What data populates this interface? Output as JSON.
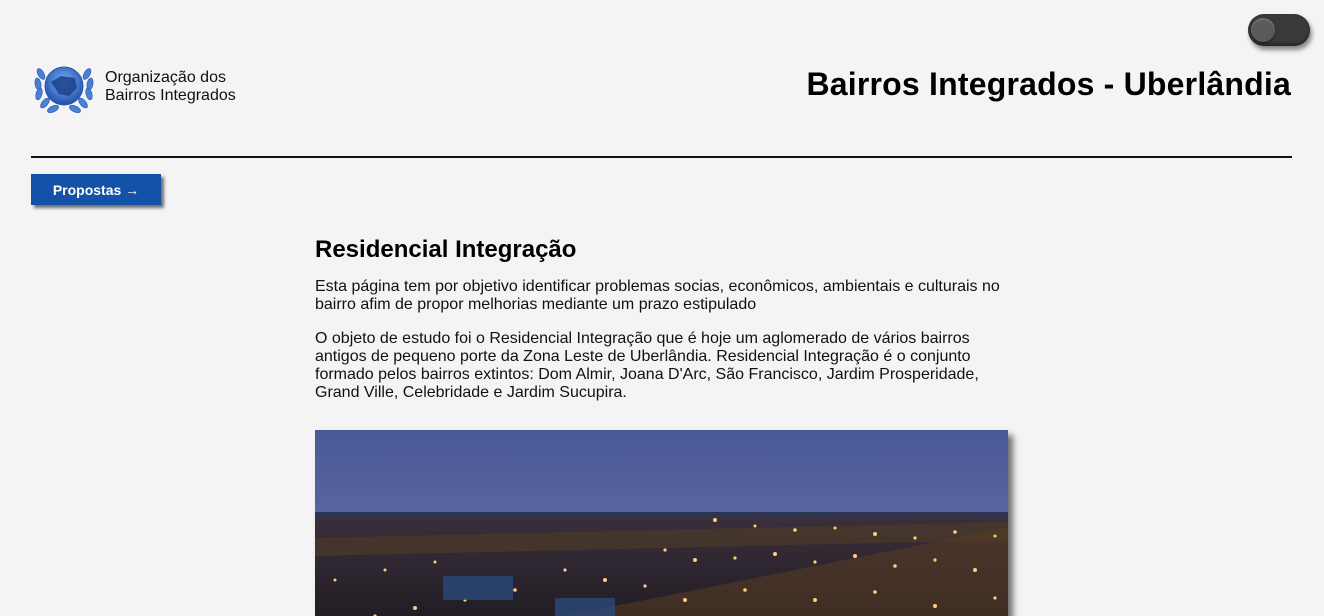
{
  "toggle": {
    "state": "off"
  },
  "header": {
    "org_line1": "Organização dos",
    "org_line2": "Bairros Integrados",
    "title": "Bairros Integrados - Uberlândia"
  },
  "nav": {
    "propostas_label": "Propostas →"
  },
  "main": {
    "heading": "Residencial Integração",
    "paragraphs": [
      "Esta página tem por objetivo identificar problemas socias, econômicos, ambientais e culturais no bairro afim de propor melhorias mediante um prazo estipulado",
      "O objeto de estudo foi o Residencial Integração que é hoje um aglomerado de vários bairros antigos de pequeno porte da Zona Leste de Uberlândia. Residencial Integração é o conjunto formado pelos bairros extintos: Dom Almir, Joana D'Arc, São Francisco, Jardim Prosperidade, Grand Ville, Celebridade e Jardim Sucupira."
    ]
  },
  "colors": {
    "background": "#f4f4f4",
    "button": "#1452a8",
    "toggle": "#3a3a3a"
  }
}
